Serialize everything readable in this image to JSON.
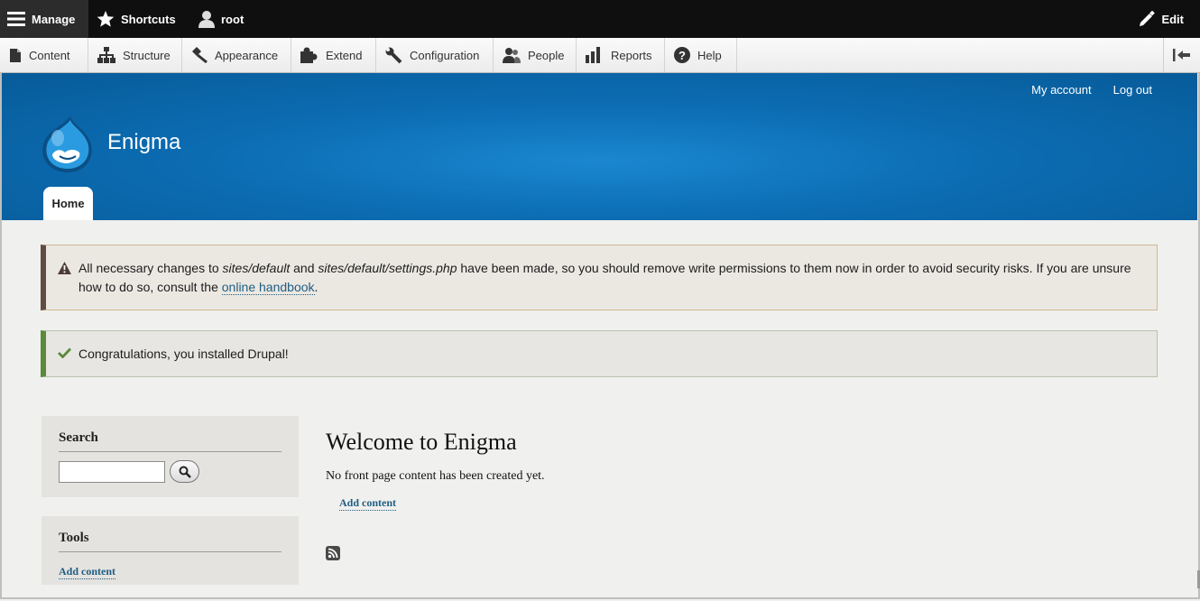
{
  "toolbar": {
    "manage_label": "Manage",
    "shortcuts_label": "Shortcuts",
    "user_label": "root",
    "edit_label": "Edit"
  },
  "tray": {
    "items": [
      {
        "label": "Content",
        "icon": "file-icon"
      },
      {
        "label": "Structure",
        "icon": "sitemap-icon"
      },
      {
        "label": "Appearance",
        "icon": "paintbrush-icon"
      },
      {
        "label": "Extend",
        "icon": "puzzle-icon"
      },
      {
        "label": "Configuration",
        "icon": "wrench-icon"
      },
      {
        "label": "People",
        "icon": "people-icon"
      },
      {
        "label": "Reports",
        "icon": "bar-chart-icon"
      },
      {
        "label": "Help",
        "icon": "help-icon"
      }
    ]
  },
  "header": {
    "site_name": "Enigma",
    "secondary_menu": [
      "My account",
      "Log out"
    ],
    "home_tab": "Home"
  },
  "messages": {
    "warning": {
      "t1": "All necessary changes to ",
      "path1": "sites/default",
      "t2": " and ",
      "path2": "sites/default/settings.php",
      "t3": " have been made, so you should remove write permissions to them now in order to avoid security risks. If you are unsure how to do so, consult the ",
      "link": "online handbook",
      "t4": "."
    },
    "status": "Congratulations, you installed Drupal!"
  },
  "sidebar": {
    "search_title": "Search",
    "search_value": "",
    "tools_title": "Tools",
    "tools_link": "Add content"
  },
  "main": {
    "title": "Welcome to Enigma",
    "text": "No front page content has been created yet.",
    "add_content": "Add content"
  },
  "colors": {
    "toolbar_bg": "#0f0f0f",
    "header_blue": "#0c6db3",
    "link": "#1f5d82",
    "warning_border": "#5f4d43",
    "status_border": "#5c8a3b"
  }
}
